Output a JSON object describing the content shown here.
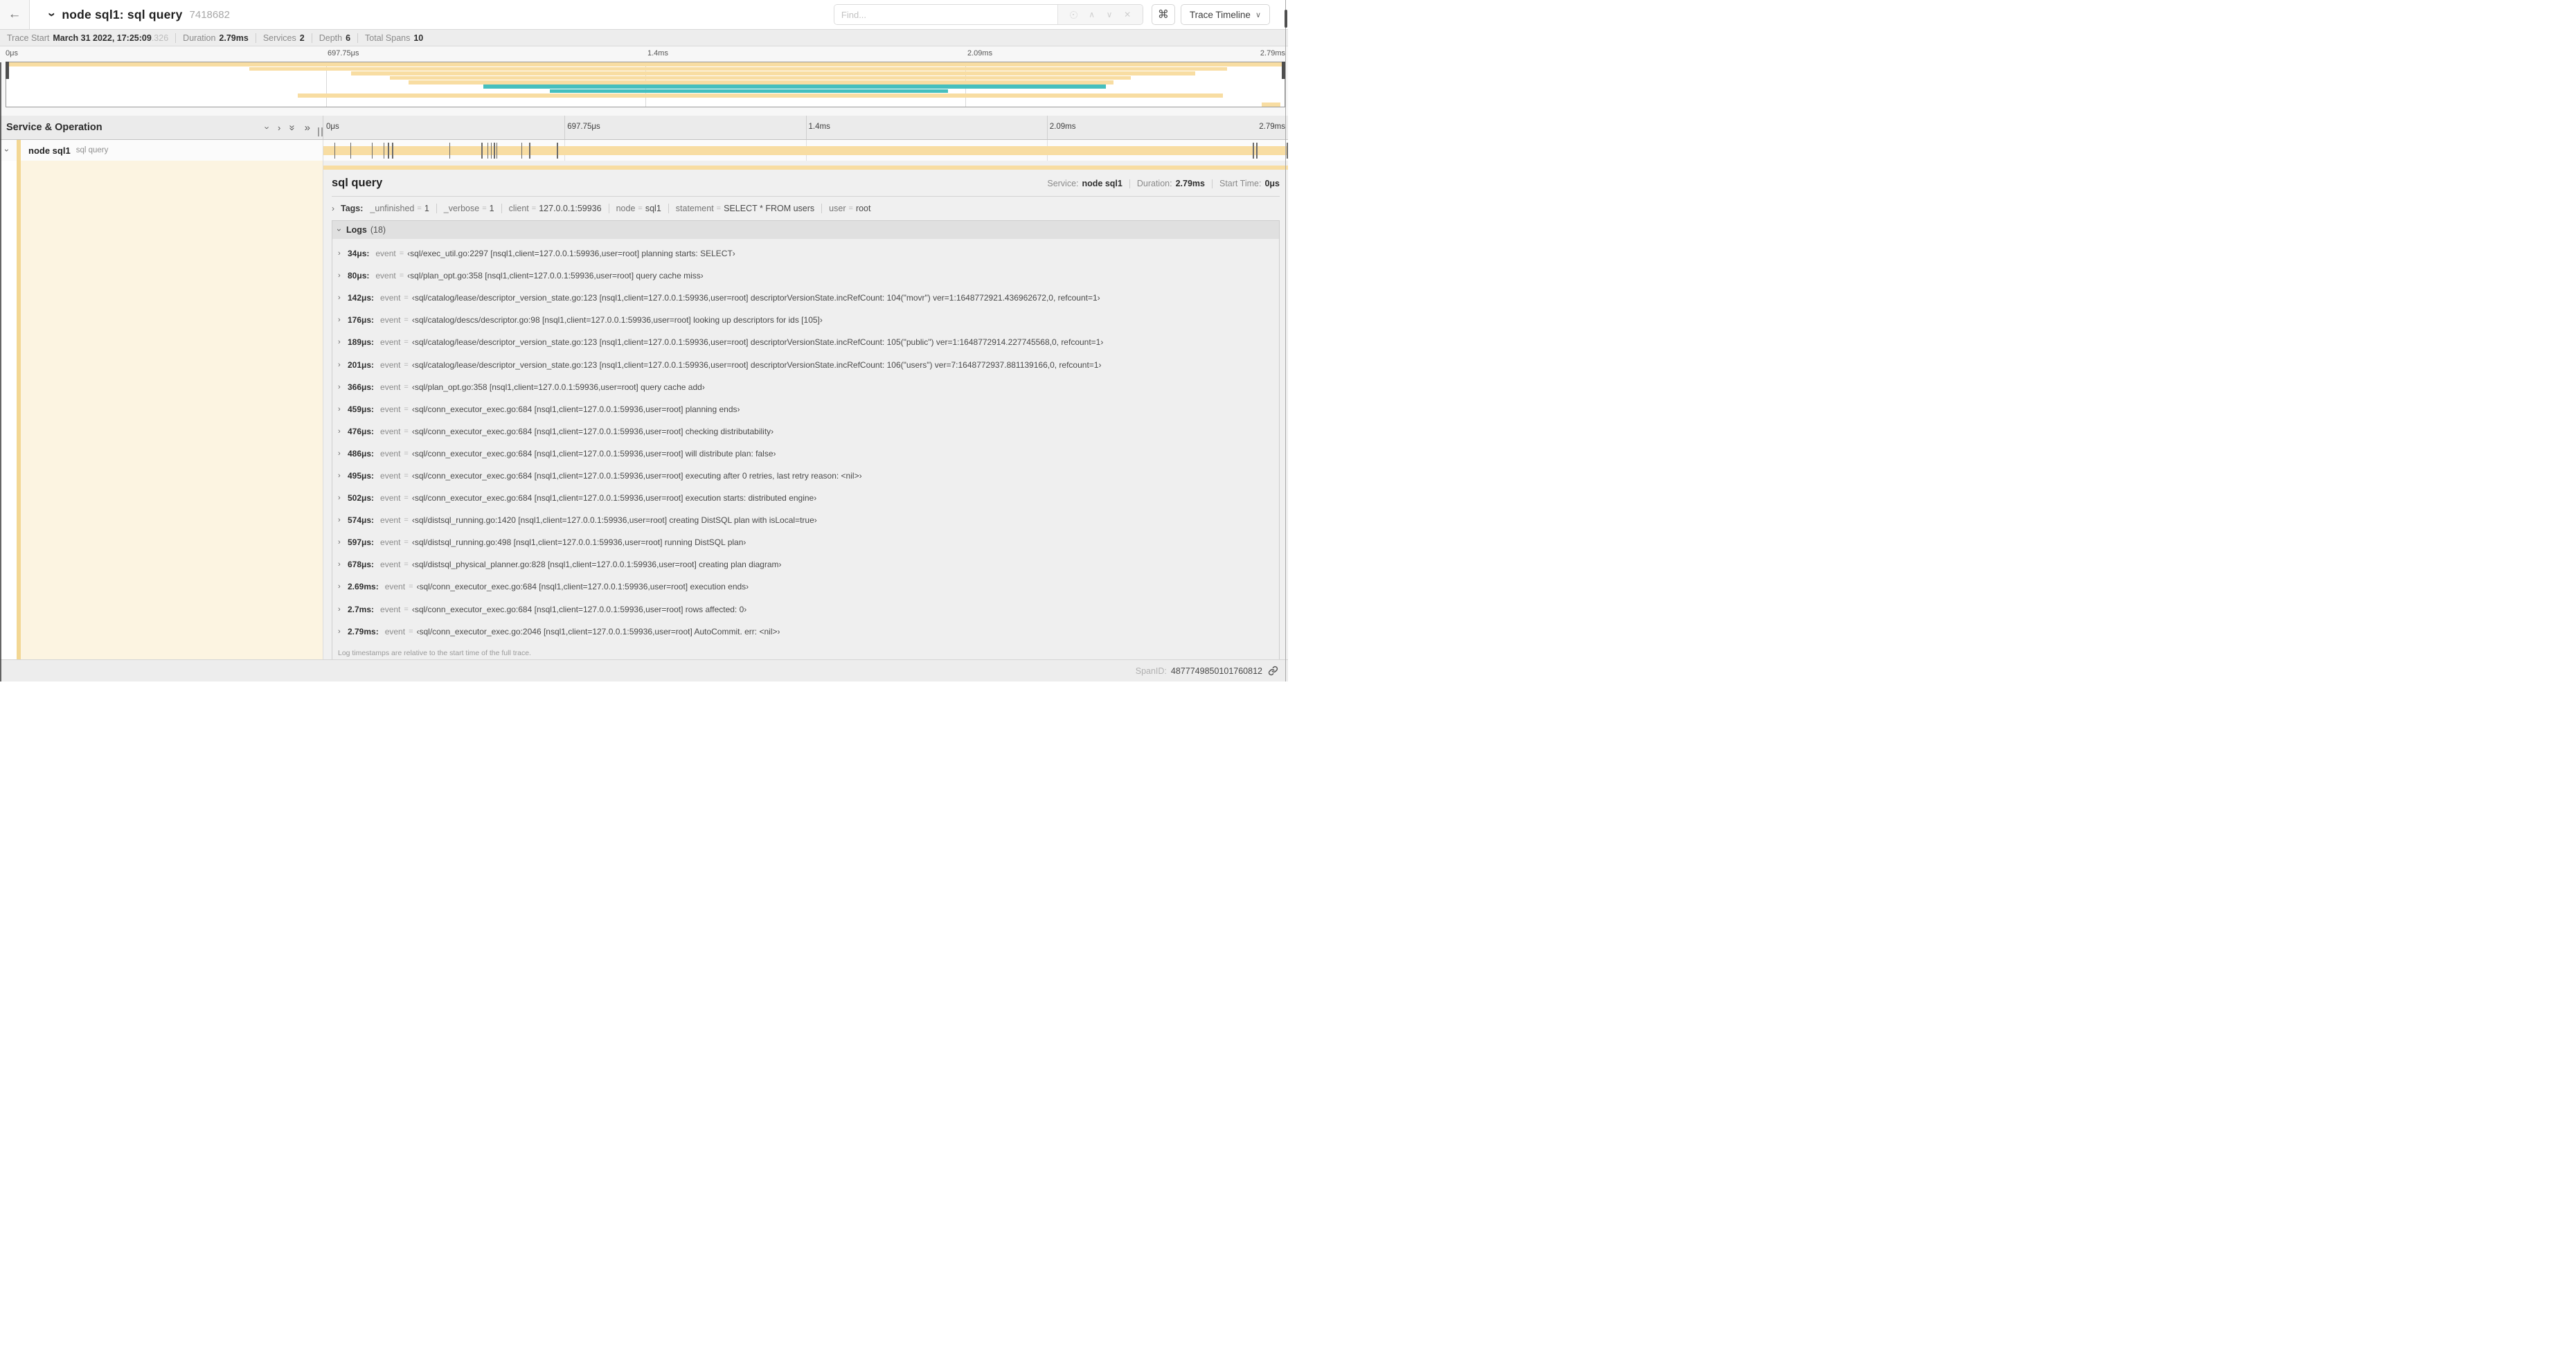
{
  "colors": {
    "tan": "#F8DDA2",
    "teal": "#45BFBE",
    "accent": "#F3D794",
    "cream": "#FCF4E1",
    "marker": "#6a6a6a"
  },
  "header": {
    "back_icon": "←",
    "title": "node sql1: sql query",
    "trace_id": "7418682",
    "find_placeholder": "Find...",
    "command_symbol": "⌘",
    "view_button_label": "Trace Timeline"
  },
  "trace_info": {
    "items": [
      {
        "label": "Trace Start",
        "value": "March 31 2022, 17:25:09",
        "suffix": ".326"
      },
      {
        "label": "Duration",
        "value": "2.79ms"
      },
      {
        "label": "Services",
        "value": "2"
      },
      {
        "label": "Depth",
        "value": "6"
      },
      {
        "label": "Total Spans",
        "value": "10"
      }
    ]
  },
  "minimap": {
    "axis_labels": [
      "0μs",
      "697.75μs",
      "1.4ms",
      "2.09ms",
      "2.79ms"
    ],
    "spans": [
      {
        "start": 0.0,
        "end": 1.0,
        "color": "tan"
      },
      {
        "start": 0.19,
        "end": 0.955,
        "color": "tan"
      },
      {
        "start": 0.27,
        "end": 0.93,
        "color": "tan"
      },
      {
        "start": 0.3,
        "end": 0.88,
        "color": "tan"
      },
      {
        "start": 0.315,
        "end": 0.866,
        "color": "tan"
      },
      {
        "start": 0.373,
        "end": 0.86,
        "color": "teal"
      },
      {
        "start": 0.425,
        "end": 0.737,
        "color": "teal"
      },
      {
        "start": 0.228,
        "end": 0.952,
        "color": "tan"
      },
      {
        "start": 0.0,
        "end": 0.0,
        "color": "tan"
      },
      {
        "start": 0.982,
        "end": 0.997,
        "color": "tan"
      }
    ]
  },
  "timeline": {
    "left_header": "Service & Operation",
    "ticks": [
      "0μs",
      "697.75μs",
      "1.4ms",
      "2.09ms",
      "2.79ms"
    ],
    "row": {
      "service": "node sql1",
      "operation": "sql query",
      "bar": {
        "start": 0.0,
        "end": 1.0,
        "color": "tan"
      },
      "log_marker_fractions": [
        0.0122,
        0.0287,
        0.0509,
        0.0631,
        0.0677,
        0.072,
        0.1312,
        0.1645,
        0.1706,
        0.1742,
        0.1774,
        0.1799,
        0.2057,
        0.214,
        0.243,
        0.9642,
        0.9677,
        0.9996
      ]
    }
  },
  "detail": {
    "title": "sql query",
    "meta": {
      "service_label": "Service:",
      "service": "node sql1",
      "duration_label": "Duration:",
      "duration": "2.79ms",
      "start_label": "Start Time:",
      "start": "0μs"
    },
    "tags": {
      "label": "Tags:",
      "items": [
        {
          "key": "_unfinished",
          "value": "1"
        },
        {
          "key": "_verbose",
          "value": "1"
        },
        {
          "key": "client",
          "value": "127.0.0.1:59936"
        },
        {
          "key": "node",
          "value": "sql1"
        },
        {
          "key": "statement",
          "value": "SELECT * FROM users"
        },
        {
          "key": "user",
          "value": "root"
        }
      ]
    },
    "logs": {
      "label": "Logs",
      "count": "(18)",
      "entries": [
        {
          "time": "34μs:",
          "key": "event",
          "value": "‹sql/exec_util.go:2297 [nsql1,client=127.0.0.1:59936,user=root] planning starts: SELECT›"
        },
        {
          "time": "80μs:",
          "key": "event",
          "value": "‹sql/plan_opt.go:358 [nsql1,client=127.0.0.1:59936,user=root] query cache miss›"
        },
        {
          "time": "142μs:",
          "key": "event",
          "value": "‹sql/catalog/lease/descriptor_version_state.go:123 [nsql1,client=127.0.0.1:59936,user=root] descriptorVersionState.incRefCount: 104(\"movr\") ver=1:1648772921.436962672,0, refcount=1›"
        },
        {
          "time": "176μs:",
          "key": "event",
          "value": "‹sql/catalog/descs/descriptor.go:98 [nsql1,client=127.0.0.1:59936,user=root] looking up descriptors for ids [105]›"
        },
        {
          "time": "189μs:",
          "key": "event",
          "value": "‹sql/catalog/lease/descriptor_version_state.go:123 [nsql1,client=127.0.0.1:59936,user=root] descriptorVersionState.incRefCount: 105(\"public\") ver=1:1648772914.227745568,0, refcount=1›"
        },
        {
          "time": "201μs:",
          "key": "event",
          "value": "‹sql/catalog/lease/descriptor_version_state.go:123 [nsql1,client=127.0.0.1:59936,user=root] descriptorVersionState.incRefCount: 106(\"users\") ver=7:1648772937.881139166,0, refcount=1›"
        },
        {
          "time": "366μs:",
          "key": "event",
          "value": "‹sql/plan_opt.go:358 [nsql1,client=127.0.0.1:59936,user=root] query cache add›"
        },
        {
          "time": "459μs:",
          "key": "event",
          "value": "‹sql/conn_executor_exec.go:684 [nsql1,client=127.0.0.1:59936,user=root] planning ends›"
        },
        {
          "time": "476μs:",
          "key": "event",
          "value": "‹sql/conn_executor_exec.go:684 [nsql1,client=127.0.0.1:59936,user=root] checking distributability›"
        },
        {
          "time": "486μs:",
          "key": "event",
          "value": "‹sql/conn_executor_exec.go:684 [nsql1,client=127.0.0.1:59936,user=root] will distribute plan: false›"
        },
        {
          "time": "495μs:",
          "key": "event",
          "value": "‹sql/conn_executor_exec.go:684 [nsql1,client=127.0.0.1:59936,user=root] executing after 0 retries, last retry reason: <nil>›"
        },
        {
          "time": "502μs:",
          "key": "event",
          "value": "‹sql/conn_executor_exec.go:684 [nsql1,client=127.0.0.1:59936,user=root] execution starts: distributed engine›"
        },
        {
          "time": "574μs:",
          "key": "event",
          "value": "‹sql/distsql_running.go:1420 [nsql1,client=127.0.0.1:59936,user=root] creating DistSQL plan with isLocal=true›"
        },
        {
          "time": "597μs:",
          "key": "event",
          "value": "‹sql/distsql_running.go:498 [nsql1,client=127.0.0.1:59936,user=root] running DistSQL plan›"
        },
        {
          "time": "678μs:",
          "key": "event",
          "value": "‹sql/distsql_physical_planner.go:828 [nsql1,client=127.0.0.1:59936,user=root] creating plan diagram›"
        },
        {
          "time": "2.69ms:",
          "key": "event",
          "value": "‹sql/conn_executor_exec.go:684 [nsql1,client=127.0.0.1:59936,user=root] execution ends›"
        },
        {
          "time": "2.7ms:",
          "key": "event",
          "value": "‹sql/conn_executor_exec.go:684 [nsql1,client=127.0.0.1:59936,user=root] rows affected: 0›"
        },
        {
          "time": "2.79ms:",
          "key": "event",
          "value": "‹sql/conn_executor_exec.go:2046 [nsql1,client=127.0.0.1:59936,user=root] AutoCommit. err: <nil>›"
        }
      ]
    },
    "footer_note": "Log timestamps are relative to the start time of the full trace.",
    "spanid_label": "SpanID:",
    "spanid": "4877749850101760812"
  }
}
